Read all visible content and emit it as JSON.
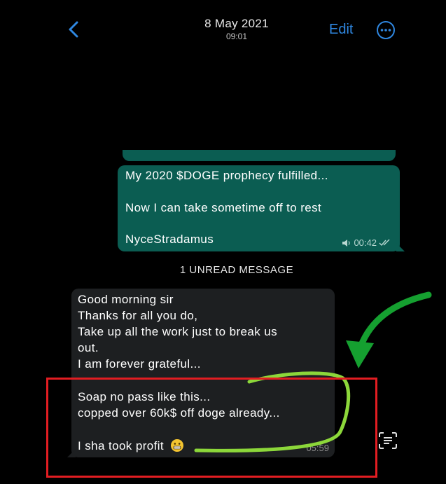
{
  "header": {
    "date": "8 May 2021",
    "time": "09:01",
    "edit_label": "Edit",
    "back_icon": "chevron-left-icon",
    "more_icon": "ellipsis-circle-icon",
    "accent_color": "#2f87e0"
  },
  "outgoing_message": {
    "lines": [
      "My  2020 $DOGE prophecy fulfilled...",
      "Now I can take sometime off to rest",
      "NyceStradamus"
    ],
    "time": "00:42",
    "bubble_color": "#0b5d52",
    "status_icon": "double-check-icon",
    "voice_icon": "speaker-icon"
  },
  "unread_banner": "1 UNREAD MESSAGE",
  "incoming_message": {
    "lines": [
      "Good morning sir",
      "Thanks for all you do,",
      "Take up all the work just to break us",
      "out.",
      "I am forever grateful...",
      "Soap no pass like this...",
      "copped over 60k$ off doge already...",
      "I sha took profit"
    ],
    "time": "05:59",
    "emoji": "grinning-face-emoji",
    "bubble_color": "#1d1f21"
  },
  "annotations": {
    "highlight_box_color": "#e21d22",
    "arrow_color": "#15a030",
    "underline_color": "#8cd73a"
  }
}
